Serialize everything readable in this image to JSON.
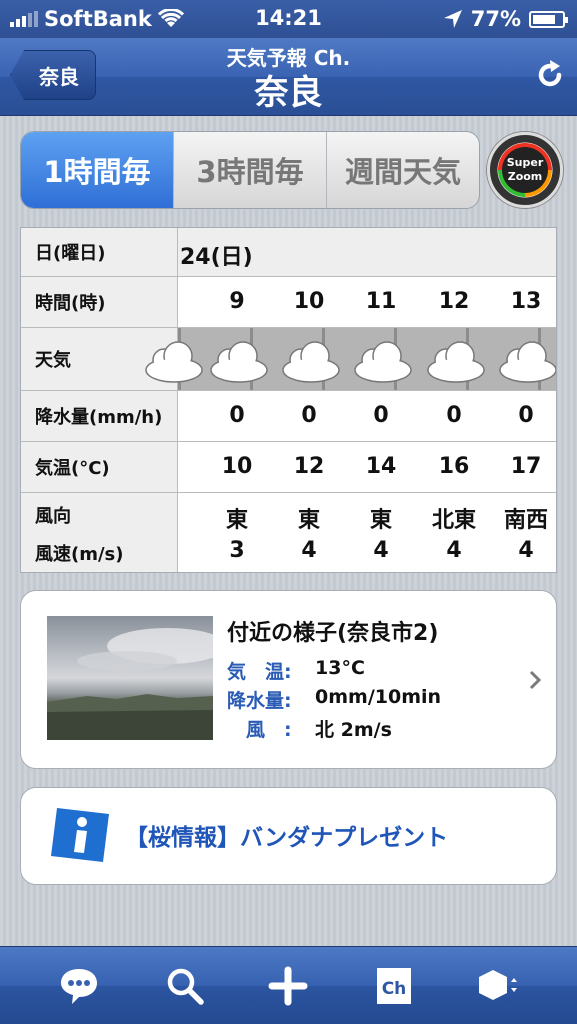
{
  "status_bar": {
    "carrier": "SoftBank",
    "time": "14:21",
    "battery": "77%",
    "battery_level": 0.77
  },
  "nav": {
    "back_label": "奈良",
    "subtitle": "天気予報 Ch.",
    "title": "奈良"
  },
  "tabs": {
    "items": [
      "1時間毎",
      "3時間毎",
      "週間天気"
    ],
    "selected": 0,
    "zoom_line1": "Super",
    "zoom_line2": "Zoom"
  },
  "forecast": {
    "labels": {
      "day": "日(曜日)",
      "hour": "時間(時)",
      "weather": "天気",
      "precip": "降水量(mm/h)",
      "temp": "気温(°C)",
      "wind_dir": "風向",
      "wind_speed": "風速(m/s)"
    },
    "day": "24(日)",
    "hours": [
      "9",
      "10",
      "11",
      "12",
      "13"
    ],
    "weather": [
      "cloudy",
      "cloudy",
      "cloudy",
      "cloudy",
      "cloudy"
    ],
    "precip": [
      "0",
      "0",
      "0",
      "0",
      "0"
    ],
    "temp": [
      "10",
      "12",
      "14",
      "16",
      "17"
    ],
    "wind_dir": [
      "東",
      "東",
      "東",
      "北東",
      "南西"
    ],
    "wind_speed": [
      "3",
      "4",
      "4",
      "4",
      "4"
    ]
  },
  "nearby": {
    "title": "付近の様子(奈良市2)",
    "rows": [
      {
        "key": "気　温:",
        "value": "13°C"
      },
      {
        "key": "降水量:",
        "value": "0mm/10min"
      },
      {
        "key": "　風　:",
        "value": "北 2m/s"
      }
    ]
  },
  "banner": {
    "text": "【桜情報】バンダナプレゼント"
  },
  "colors": {
    "accent_blue": "#2f57a3",
    "segment_active": "#2f6fd6",
    "link_blue": "#1f56b8"
  }
}
